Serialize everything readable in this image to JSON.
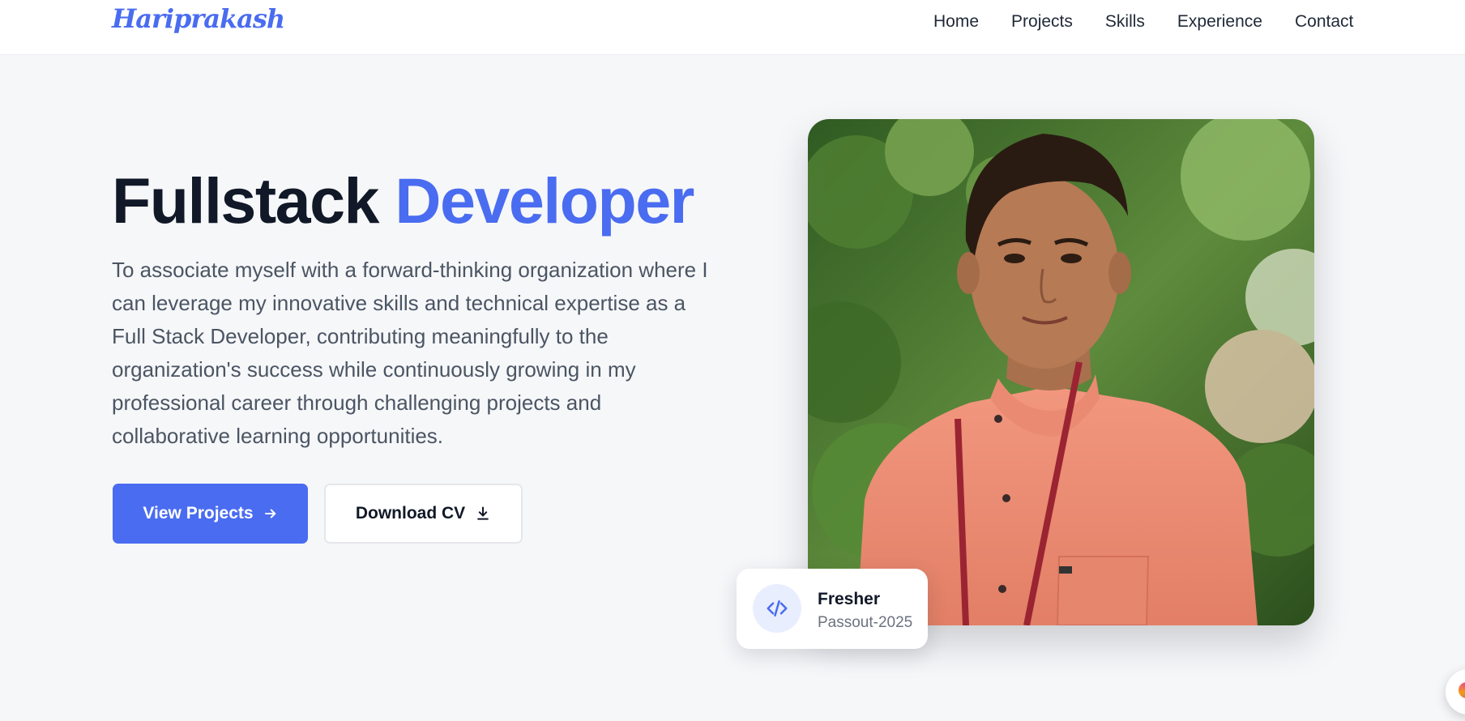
{
  "brand": {
    "logo_text": "Hariprakash"
  },
  "nav": {
    "items": [
      {
        "label": "Home"
      },
      {
        "label": "Projects"
      },
      {
        "label": "Skills"
      },
      {
        "label": "Experience"
      },
      {
        "label": "Contact"
      }
    ]
  },
  "hero": {
    "title_part1": "Fullstack",
    "title_part2": "Developer",
    "description": "To associate myself with a forward-thinking organization where I can leverage my innovative skills and technical expertise as a Full Stack Developer, contributing meaningfully to the organization's success while continuously growing in my professional career through challenging projects and collaborative learning opportunities.",
    "primary_button": {
      "label": "View Projects",
      "icon": "arrow-right-icon"
    },
    "secondary_button": {
      "label": "Download CV",
      "icon": "download-icon"
    }
  },
  "profile_card": {
    "icon": "code-icon",
    "title": "Fresher",
    "subtitle": "Passout-2025"
  },
  "colors": {
    "accent": "#4a6cf0",
    "heading": "#111827",
    "body_text": "#4b5563",
    "background": "#f6f7f9"
  }
}
